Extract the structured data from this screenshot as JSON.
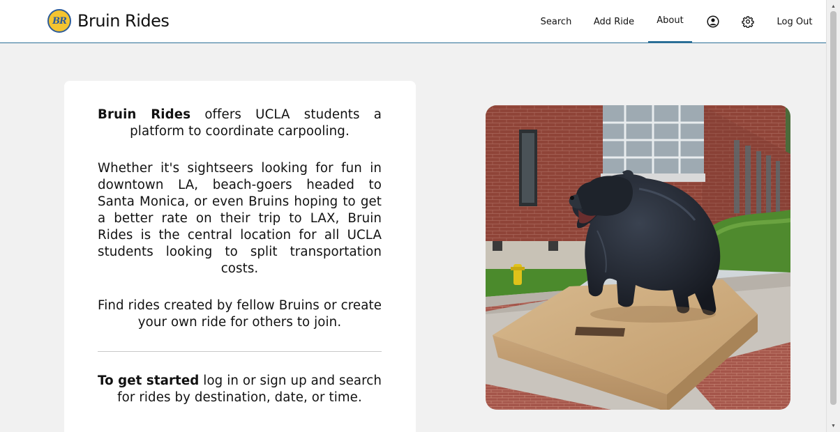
{
  "app": {
    "name": "Bruin Rides",
    "logo_text": "BR"
  },
  "nav": {
    "search": "Search",
    "add_ride": "Add Ride",
    "about": "About",
    "logout": "Log Out",
    "profile_icon": "user-circle-icon",
    "settings_icon": "gear-icon"
  },
  "about": {
    "p1_bold": "Bruin Rides",
    "p1_rest": " offers UCLA students a platform to coordinate carpooling.",
    "p2": "Whether it's sightseers looking for fun in downtown LA, beach-goers headed to Santa Monica, or even Bruins hoping to get a better rate on their trip to LAX, Bruin Rides is the central location for all UCLA students looking to split transportation costs.",
    "p3": "Find rides created by fellow Bruins or create your own ride for others to join.",
    "p4_bold": "To get started",
    "p4_rest": " log in or sign up and search for rides by destination, date, or time."
  },
  "colors": {
    "accent": "#2a6f97",
    "logo_gold": "#f4c430",
    "logo_blue": "#2d5c9a",
    "page_bg": "#f1f1f1"
  }
}
